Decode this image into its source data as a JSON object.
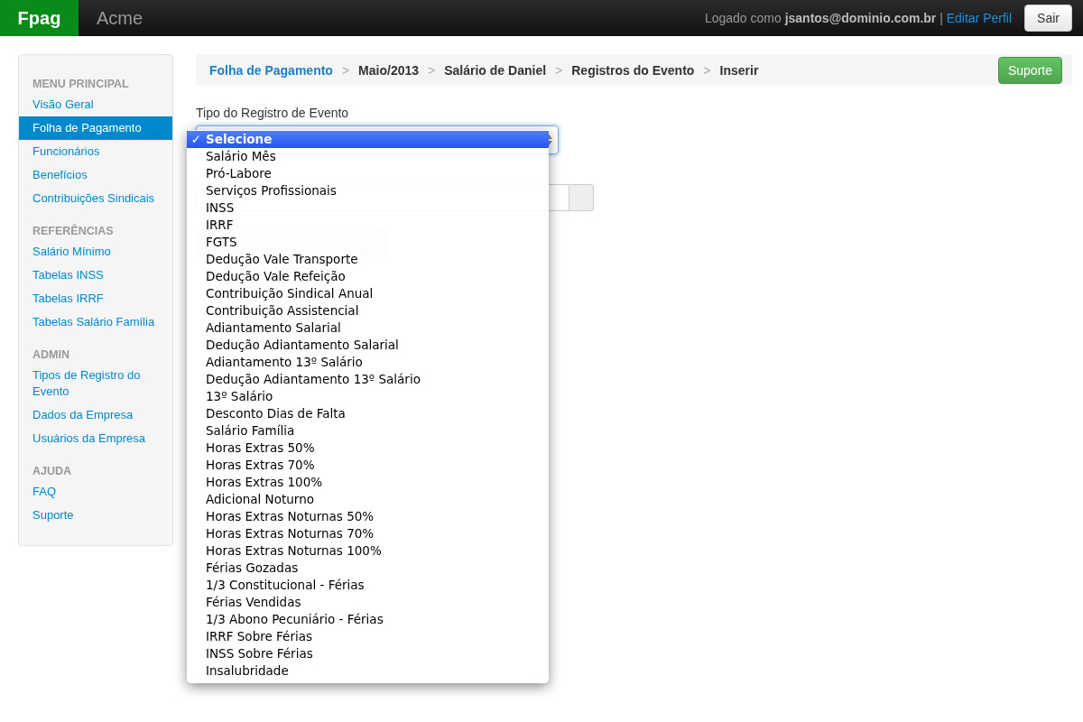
{
  "navbar": {
    "brand": "Fpag",
    "company": "Acme",
    "logged_prefix": "Logado como",
    "user": "jsantos@dominio.com.br",
    "separator": "|",
    "edit_profile": "Editar Perfil",
    "logout": "Sair"
  },
  "sidebar": {
    "sections": [
      {
        "header": "MENU PRINCIPAL",
        "items": [
          {
            "label": "Visão Geral",
            "selected": false
          },
          {
            "label": "Folha de Pagamento",
            "selected": true
          },
          {
            "label": "Funcionários",
            "selected": false
          },
          {
            "label": "Benefícios",
            "selected": false
          },
          {
            "label": "Contribuições Sindicais",
            "selected": false
          }
        ]
      },
      {
        "header": "REFERÊNCIAS",
        "items": [
          {
            "label": "Salário Mínimo",
            "selected": false
          },
          {
            "label": "Tabelas INSS",
            "selected": false
          },
          {
            "label": "Tabelas IRRF",
            "selected": false
          },
          {
            "label": "Tabelas Salário Família",
            "selected": false
          }
        ]
      },
      {
        "header": "ADMIN",
        "items": [
          {
            "label": "Tipos de Registro do Evento",
            "selected": false
          },
          {
            "label": "Dados da Empresa",
            "selected": false
          },
          {
            "label": "Usuários da Empresa",
            "selected": false
          }
        ]
      },
      {
        "header": "AJUDA",
        "items": [
          {
            "label": "FAQ",
            "selected": false
          },
          {
            "label": "Suporte",
            "selected": false
          }
        ]
      }
    ]
  },
  "breadcrumb": {
    "items": [
      {
        "label": "Folha de Pagamento",
        "kind": "link"
      },
      {
        "label": "Maio/2013",
        "kind": "text"
      },
      {
        "label": "Salário de Daniel",
        "kind": "text"
      },
      {
        "label": "Registros do Evento",
        "kind": "text"
      },
      {
        "label": "Inserir",
        "kind": "text"
      }
    ],
    "divider": ">",
    "button": "Suporte"
  },
  "form": {
    "label": "Tipo do Registro de Evento",
    "options": [
      {
        "label": "Selecione",
        "selected": true
      },
      {
        "label": "Salário Mês",
        "selected": false
      },
      {
        "label": "Pró-Labore",
        "selected": false
      },
      {
        "label": "Serviços Profissionais",
        "selected": false
      },
      {
        "label": "INSS",
        "selected": false
      },
      {
        "label": "IRRF",
        "selected": false
      },
      {
        "label": "FGTS",
        "selected": false
      },
      {
        "label": "Dedução Vale Transporte",
        "selected": false
      },
      {
        "label": "Dedução Vale Refeição",
        "selected": false
      },
      {
        "label": "Contribuição Sindical Anual",
        "selected": false
      },
      {
        "label": "Contribuição Assistencial",
        "selected": false
      },
      {
        "label": "Adiantamento Salarial",
        "selected": false
      },
      {
        "label": "Dedução Adiantamento Salarial",
        "selected": false
      },
      {
        "label": "Adiantamento 13º Salário",
        "selected": false
      },
      {
        "label": "Dedução Adiantamento 13º Salário",
        "selected": false
      },
      {
        "label": "13º Salário",
        "selected": false
      },
      {
        "label": "Desconto Dias de Falta",
        "selected": false
      },
      {
        "label": "Salário Família",
        "selected": false
      },
      {
        "label": "Horas Extras 50%",
        "selected": false
      },
      {
        "label": "Horas Extras 70%",
        "selected": false
      },
      {
        "label": "Horas Extras 100%",
        "selected": false
      },
      {
        "label": "Adicional Noturno",
        "selected": false
      },
      {
        "label": "Horas Extras Noturnas 50%",
        "selected": false
      },
      {
        "label": "Horas Extras Noturnas 70%",
        "selected": false
      },
      {
        "label": "Horas Extras Noturnas 100%",
        "selected": false
      },
      {
        "label": "Férias Gozadas",
        "selected": false
      },
      {
        "label": "1/3 Constitucional - Férias",
        "selected": false
      },
      {
        "label": "Férias Vendidas",
        "selected": false
      },
      {
        "label": "1/3 Abono Pecuniário - Férias",
        "selected": false
      },
      {
        "label": "IRRF Sobre Férias",
        "selected": false
      },
      {
        "label": "INSS Sobre Férias",
        "selected": false
      },
      {
        "label": "Insalubridade",
        "selected": false
      }
    ],
    "check": "✓"
  }
}
